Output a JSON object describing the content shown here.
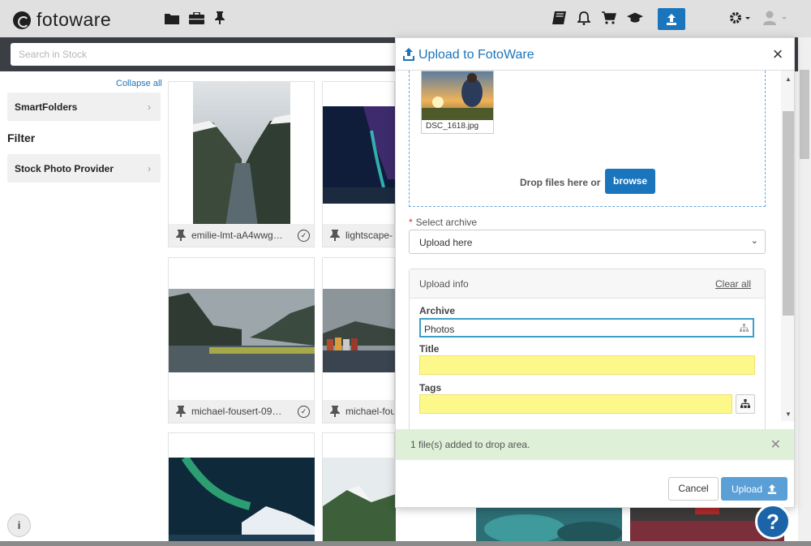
{
  "app": {
    "logo_text": "fotoware"
  },
  "topbar": {
    "icons": [
      "folder-icon",
      "briefcase-icon",
      "pin-icon",
      "book-icon",
      "bell-icon",
      "cart-icon",
      "graduation-cap-icon",
      "upload-icon",
      "gear-icon",
      "user-icon"
    ]
  },
  "search": {
    "placeholder": "Search in Stock"
  },
  "sidebar": {
    "collapse_all": "Collapse all",
    "smartfolders": "SmartFolders",
    "filter_heading": "Filter",
    "stock_provider": "Stock Photo Provider"
  },
  "grid": {
    "cards": [
      {
        "caption": "emilie-lmt-aA4wwg…"
      },
      {
        "caption": "lightscape-"
      },
      {
        "caption": "michael-fousert-09…"
      },
      {
        "caption": "michael-fou"
      }
    ]
  },
  "dialog": {
    "title": "Upload to FotoWare",
    "file_name": "DSC_1618.jpg",
    "drop_text": "Drop files here or",
    "browse": "browse",
    "select_archive_label": "Select archive",
    "select_archive_value": "Upload here",
    "upload_info": "Upload info",
    "clear_all": "Clear all",
    "archive_label": "Archive",
    "archive_value": "Photos",
    "title_label": "Title",
    "title_value": "",
    "tags_label": "Tags",
    "tags_value": "",
    "notice": "1 file(s) added to drop area.",
    "cancel": "Cancel",
    "upload": "Upload"
  },
  "help": {
    "label": "?"
  },
  "colors": {
    "accent": "#1b75bc",
    "highlight_field": "#fdf88a",
    "notice_bg": "#dff0d8"
  }
}
